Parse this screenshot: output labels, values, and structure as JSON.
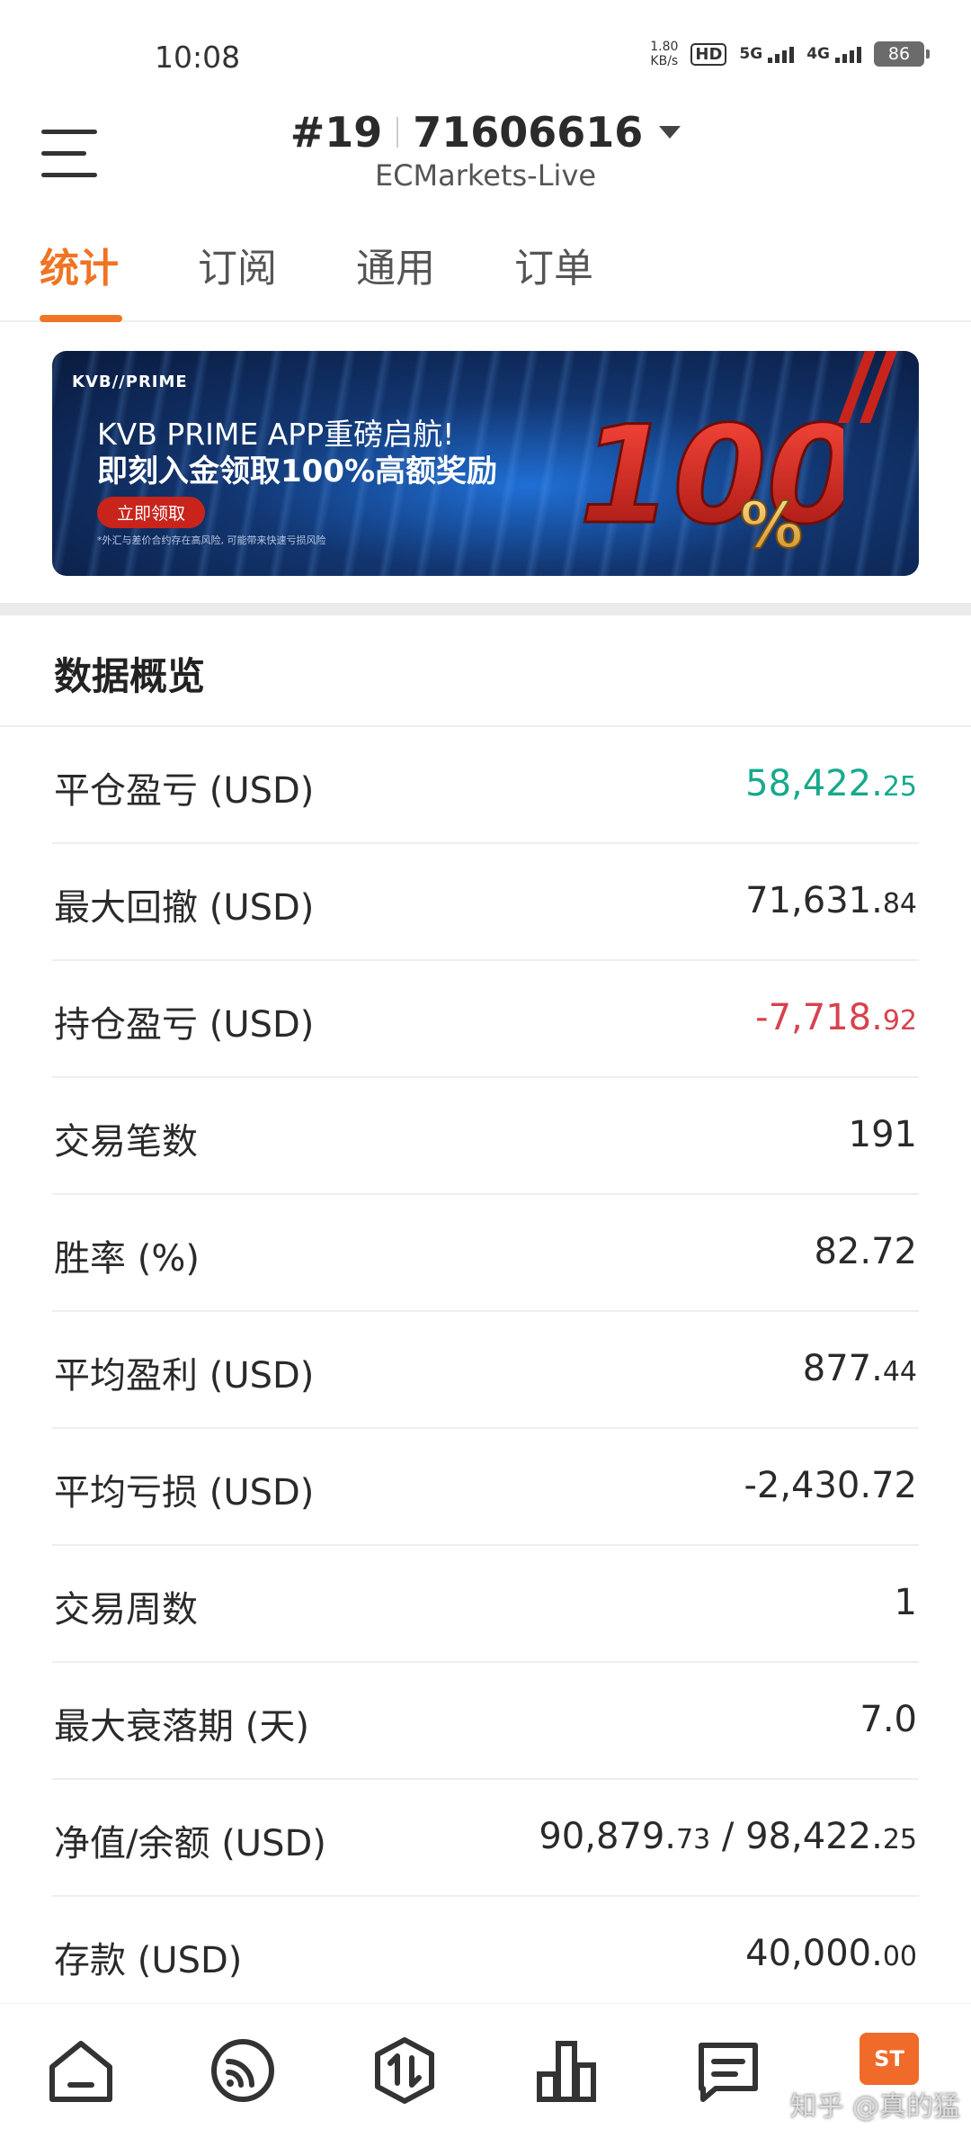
{
  "status": {
    "time": "10:08",
    "net_speed_value": "1.80",
    "net_speed_unit": "KB/s",
    "hd": "HD",
    "signal1": "5G",
    "signal2": "4G",
    "battery": "86"
  },
  "header": {
    "account_prefix": "#19",
    "account_number": "71606616",
    "server": "ECMarkets-Live"
  },
  "tabs": [
    {
      "label": "统计",
      "active": true
    },
    {
      "label": "订阅",
      "active": false
    },
    {
      "label": "通用",
      "active": false
    },
    {
      "label": "订单",
      "active": false
    }
  ],
  "banner": {
    "logo": "KVB//PRIME",
    "title": "KVB PRIME APP重磅启航!",
    "subtitle": "即刻入金领取100%高额奖励",
    "button": "立即领取",
    "note": "*外汇与差价合约存在高风险, 可能带来快速亏损风险",
    "big_number": "100",
    "big_percent": "%"
  },
  "overview": {
    "title": "数据概览",
    "rows": [
      {
        "label": "平仓盈亏 (USD)",
        "int": "58,422.",
        "dec": "25",
        "color": "green"
      },
      {
        "label": "最大回撤 (USD)",
        "int": "71,631.",
        "dec": "84",
        "color": "default"
      },
      {
        "label": "持仓盈亏 (USD)",
        "int": "-7,718.",
        "dec": "92",
        "color": "red"
      },
      {
        "label": "交易笔数",
        "int": "191",
        "dec": "",
        "color": "default"
      },
      {
        "label": "胜率 (%)",
        "int": "82.72",
        "dec": "",
        "color": "default"
      },
      {
        "label": "平均盈利 (USD)",
        "int": "877.",
        "dec": "44",
        "color": "default"
      },
      {
        "label": "平均亏损 (USD)",
        "int": "-2,430.72",
        "dec": "",
        "color": "default"
      },
      {
        "label": "交易周数",
        "int": "1",
        "dec": "",
        "color": "default"
      },
      {
        "label": "最大衰落期 (天)",
        "int": "7.0",
        "dec": "",
        "color": "default"
      },
      {
        "label": "净值/余额 (USD)",
        "int": "90,879.",
        "dec": "73",
        "int2": " / 98,422.",
        "dec2": "25",
        "color": "default"
      },
      {
        "label": "存款 (USD)",
        "int": "40,000.",
        "dec": "00",
        "color": "default"
      }
    ]
  },
  "bottom_nav": {
    "icons": [
      "home-icon",
      "signal-icon",
      "trade-icon",
      "chart-icon",
      "message-icon"
    ],
    "badge": "ST",
    "watermark": "知乎 @真的猛"
  },
  "colors": {
    "accent": "#f07423",
    "profit": "#17a98c",
    "loss": "#d9414f"
  }
}
